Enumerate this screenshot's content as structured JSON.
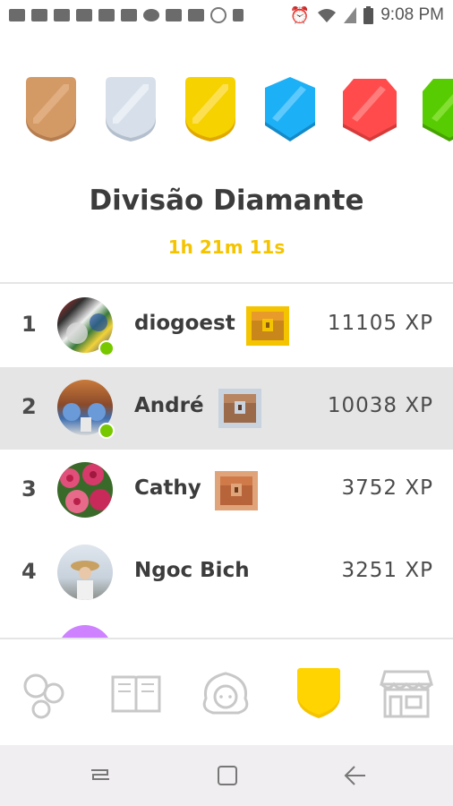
{
  "status_bar": {
    "time": "9:08 PM",
    "left_icons": [
      "message-icon",
      "youtube-icon",
      "youtube-icon",
      "youtube-icon",
      "youtube-icon",
      "youtube-icon",
      "gear-icon",
      "voicemail-icon",
      "image-icon",
      "chrome-icon",
      "sd-card-icon"
    ],
    "right_icons": [
      "alarm-icon",
      "wifi-icon",
      "signal-icon",
      "battery-icon"
    ]
  },
  "leagues": {
    "items": [
      {
        "name": "bronze",
        "color": "#d49a66"
      },
      {
        "name": "silver",
        "color": "#c9d3df"
      },
      {
        "name": "gold",
        "color": "#f5c400"
      },
      {
        "name": "sapphire",
        "color": "#1cb0f6"
      },
      {
        "name": "ruby",
        "color": "#ff4b4b"
      },
      {
        "name": "emerald",
        "color": "#58cc02"
      }
    ]
  },
  "division": {
    "title": "Divisão Diamante",
    "timer": "1h 21m 11s"
  },
  "leaderboard": [
    {
      "rank": "1",
      "name": "diogoest",
      "xp": "11105 XP",
      "chest": "gold",
      "online": true
    },
    {
      "rank": "2",
      "name": "André",
      "xp": "10038 XP",
      "chest": "silver",
      "online": true,
      "highlighted": true
    },
    {
      "rank": "3",
      "name": "Cathy",
      "xp": "3752 XP",
      "chest": "bronze",
      "online": false
    },
    {
      "rank": "4",
      "name": "Ngoc Bich",
      "xp": "3251 XP",
      "chest": "",
      "online": false
    }
  ],
  "tabs": [
    "learn-icon",
    "stories-icon",
    "profile-icon",
    "leaderboards-icon",
    "shop-icon"
  ],
  "colors": {
    "accent_gold": "#f5c400",
    "online_green": "#78c800",
    "highlight_row": "#e5e5e5",
    "text_dark": "#3c3c3c"
  }
}
